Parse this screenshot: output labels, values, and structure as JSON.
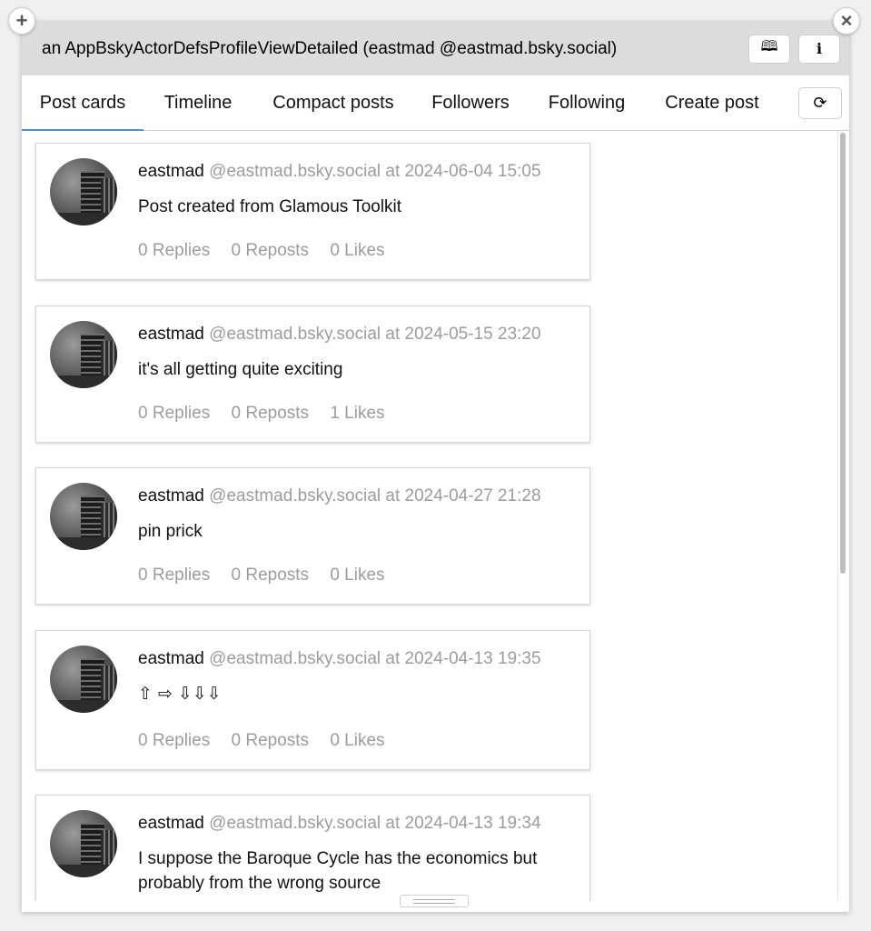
{
  "window": {
    "title": "an AppBskyActorDefsProfileViewDetailed (eastmad @eastmad.bsky.social)",
    "buttons": [
      {
        "icon": "book-icon",
        "glyph": "🕮"
      },
      {
        "icon": "info-icon",
        "glyph": "i"
      }
    ],
    "add_glyph": "+",
    "close_glyph": "×"
  },
  "tabs": [
    {
      "label": "Post cards",
      "active": true
    },
    {
      "label": "Timeline",
      "active": false
    },
    {
      "label": "Compact posts",
      "active": false
    },
    {
      "label": "Followers",
      "active": false
    },
    {
      "label": "Following",
      "active": false
    },
    {
      "label": "Create post",
      "active": false
    }
  ],
  "refresh_glyph": "⟳",
  "posts": [
    {
      "name": "eastmad",
      "handle": "@eastmad.bsky.social",
      "date": "at 2024-06-04 15:05",
      "text": "Post created from Glamous Toolkit",
      "replies": "0 Replies",
      "reposts": "0 Reposts",
      "likes": "0 Likes"
    },
    {
      "name": "eastmad",
      "handle": "@eastmad.bsky.social",
      "date": "at 2024-05-15 23:20",
      "text": "it's all getting quite exciting",
      "replies": "0 Replies",
      "reposts": "0 Reposts",
      "likes": "1 Likes"
    },
    {
      "name": "eastmad",
      "handle": "@eastmad.bsky.social",
      "date": "at 2024-04-27 21:28",
      "text": "pin prick",
      "replies": "0 Replies",
      "reposts": "0 Reposts",
      "likes": "0 Likes"
    },
    {
      "name": "eastmad",
      "handle": "@eastmad.bsky.social",
      "date": "at 2024-04-13 19:35",
      "text": "⇧ ⇨ ⇩⇩⇩",
      "replies": "0 Replies",
      "reposts": "0 Reposts",
      "likes": "0 Likes"
    },
    {
      "name": "eastmad",
      "handle": "@eastmad.bsky.social",
      "date": "at 2024-04-13 19:34",
      "text": "I suppose the Baroque Cycle has the economics but probably from the wrong source",
      "replies": "",
      "reposts": "",
      "likes": ""
    }
  ],
  "colors": {
    "accent": "#4a90d9",
    "muted": "#9c9c9c",
    "titlebar": "#dcdcdc"
  }
}
